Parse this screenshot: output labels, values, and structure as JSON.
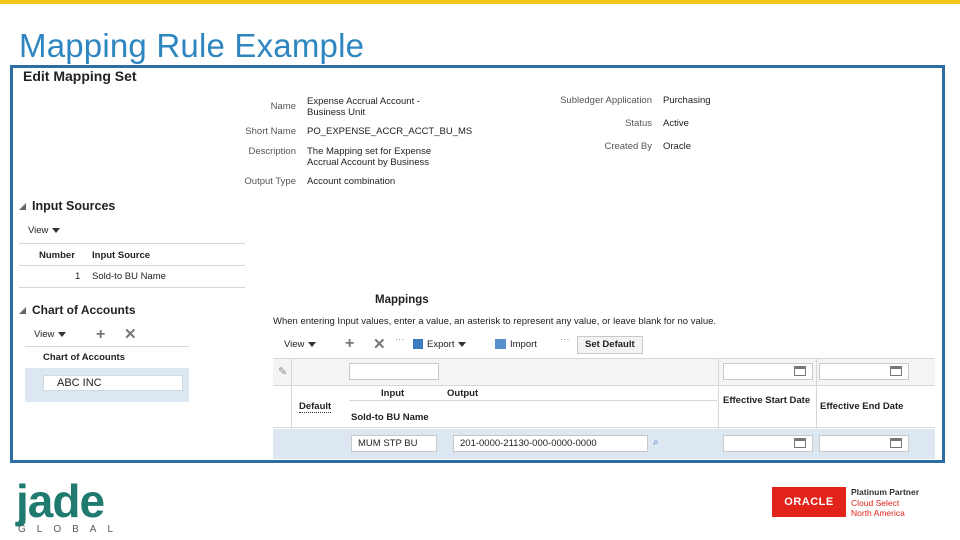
{
  "slide": {
    "title": "Mapping Rule Example"
  },
  "screen": {
    "page_title": "Edit Mapping Set",
    "header": {
      "name_label": "Name",
      "name_value_line1": "Expense Accrual Account -",
      "name_value_line2": "Business Unit",
      "short_name_label": "Short Name",
      "short_name_value": "PO_EXPENSE_ACCR_ACCT_BU_MS",
      "description_label": "Description",
      "description_value_line1": "The Mapping set for Expense",
      "description_value_line2": "Accrual Account by Business",
      "output_type_label": "Output Type",
      "output_type_value": "Account combination",
      "subledger_label": "Subledger Application",
      "subledger_value": "Purchasing",
      "status_label": "Status",
      "status_value": "Active",
      "created_by_label": "Created By",
      "created_by_value": "Oracle"
    },
    "input_sources": {
      "section_title": "Input Sources",
      "view_label": "View",
      "columns": [
        "Number",
        "Input Source"
      ],
      "rows": [
        {
          "number": "1",
          "source": "Sold-to BU Name"
        }
      ]
    },
    "chart_of_accounts": {
      "section_title": "Chart of Accounts",
      "view_label": "View",
      "column": "Chart of Accounts",
      "rows": [
        "ABC INC"
      ]
    },
    "mappings": {
      "section_title": "Mappings",
      "instruction": "When entering Input values, enter a value, an asterisk to represent any value, or leave blank for no value.",
      "toolbar": {
        "view_label": "View",
        "export_label": "Export",
        "import_label": "Import",
        "set_default_label": "Set Default"
      },
      "columns": {
        "default": "Default",
        "input": "Input",
        "input_sub": "Sold-to BU Name",
        "output": "Output",
        "eff_start": "Effective Start Date",
        "eff_end": "Effective End Date"
      },
      "row": {
        "input": "MUM STP BU",
        "output": "201-0000-21130-000-0000-0000"
      }
    }
  },
  "footer": {
    "logo_word": "jade",
    "logo_sub": "GLOBAL",
    "oracle_label": "ORACLE",
    "partner_line1": "Platinum Partner",
    "partner_line2": "Cloud Select",
    "partner_line3": "North America"
  }
}
